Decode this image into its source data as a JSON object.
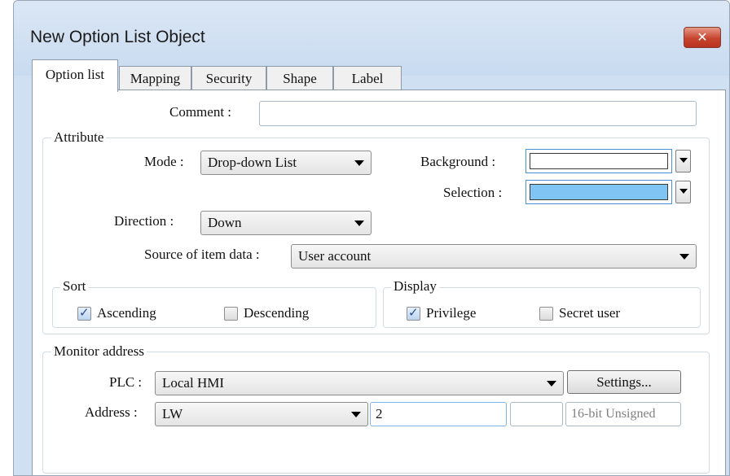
{
  "window": {
    "title": "New Option List Object",
    "close_symbol": "✕"
  },
  "tabs": [
    {
      "label": "Option list",
      "active": true
    },
    {
      "label": "Mapping"
    },
    {
      "label": "Security"
    },
    {
      "label": "Shape"
    },
    {
      "label": "Label"
    }
  ],
  "comment": {
    "label": "Comment :",
    "value": ""
  },
  "attribute": {
    "group_label": "Attribute",
    "mode": {
      "label": "Mode :",
      "value": "Drop-down List"
    },
    "background": {
      "label": "Background :",
      "color": "#ffffff"
    },
    "selection": {
      "label": "Selection :",
      "color": "#7fc4f2"
    },
    "direction": {
      "label": "Direction :",
      "value": "Down"
    },
    "source": {
      "label": "Source of item data :",
      "value": "User account"
    },
    "sort": {
      "group_label": "Sort",
      "ascending": {
        "label": "Ascending",
        "checked": true
      },
      "descending": {
        "label": "Descending",
        "checked": false
      }
    },
    "display": {
      "group_label": "Display",
      "privilege": {
        "label": "Privilege",
        "checked": true
      },
      "secret_user": {
        "label": "Secret user",
        "checked": false
      }
    }
  },
  "monitor": {
    "group_label": "Monitor address",
    "plc": {
      "label": "PLC :",
      "value": "Local HMI",
      "settings_label": "Settings..."
    },
    "address": {
      "label": "Address :",
      "device": "LW",
      "value": "2",
      "extra": "",
      "format": "16-bit Unsigned"
    }
  }
}
